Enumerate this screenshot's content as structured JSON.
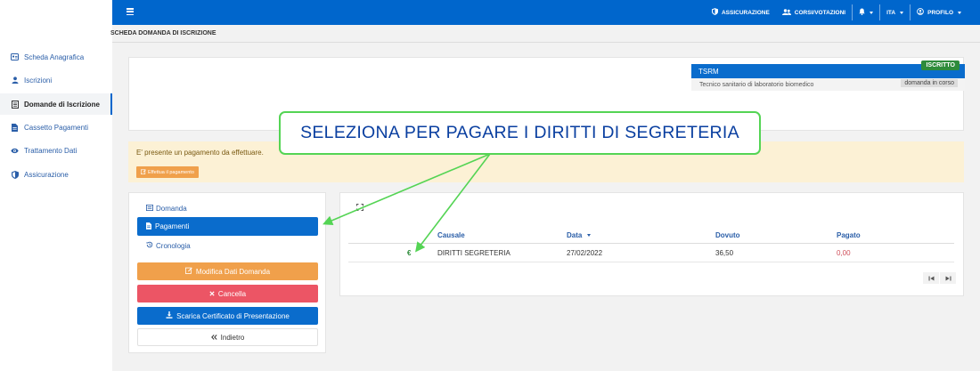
{
  "topbar": {
    "menu_icon": "hamburger-icon",
    "items": [
      {
        "label": "ASSICURAZIONE",
        "icon": "shield-icon"
      },
      {
        "label": "CORSI/VOTAZIONI",
        "icon": "users-icon"
      },
      {
        "label": "",
        "icon": "bell-icon"
      },
      {
        "label": "ITA",
        "icon": ""
      },
      {
        "label": "PROFILO",
        "icon": "user-circle-icon"
      }
    ]
  },
  "sidebar": {
    "items": [
      {
        "label": "Scheda Anagrafica",
        "icon": "id-card-icon"
      },
      {
        "label": "Iscrizioni",
        "icon": "user-icon"
      },
      {
        "label": "Domande di Iscrizione",
        "icon": "document-icon"
      },
      {
        "label": "Cassetto Pagamenti",
        "icon": "file-icon"
      },
      {
        "label": "Trattamento Dati",
        "icon": "eye-icon"
      },
      {
        "label": "Assicurazione",
        "icon": "shield-icon"
      }
    ],
    "active_index": 2
  },
  "breadcrumb": "SCHEDA DOMANDA DI ISCRIZIONE",
  "info": {
    "title": "TSRM",
    "status_badge": "ISCRITTO",
    "description": "Tecnico sanitario di laboratorio biomedico",
    "state_badge": "domanda in corso"
  },
  "alert": {
    "text": "E' presente un pagamento da effettuare.",
    "button_label": "Effettua il pagamento"
  },
  "left_panel": {
    "tabs": [
      {
        "label": "Domanda",
        "icon": "list-icon"
      },
      {
        "label": "Pagamenti",
        "icon": "file-icon"
      },
      {
        "label": "Cronologia",
        "icon": "history-icon"
      }
    ],
    "active_tab": 1,
    "buttons": {
      "edit": "Modifica Dati Domanda",
      "cancel": "Cancella",
      "download": "Scarica Certificato di Presentazione",
      "back": "Indietro"
    }
  },
  "payments_table": {
    "columns": [
      "Causale",
      "Data",
      "Dovuto",
      "Pagato"
    ],
    "sort_column": "Data",
    "rows": [
      {
        "icon_glyph": "€",
        "causale": "DIRITTI SEGRETERIA",
        "data": "27/02/2022",
        "dovuto": "36,50",
        "pagato": "0,00"
      }
    ]
  },
  "callout": {
    "text": "SELEZIONA PER PAGARE I DIRITTI DI SEGRETERIA",
    "border_color": "#54d454"
  },
  "colors": {
    "primary": "#0066cc",
    "success": "#2e8b3b",
    "warning": "#f0a04b",
    "danger": "#ec5565",
    "alert_bg": "#fcf1d5"
  }
}
